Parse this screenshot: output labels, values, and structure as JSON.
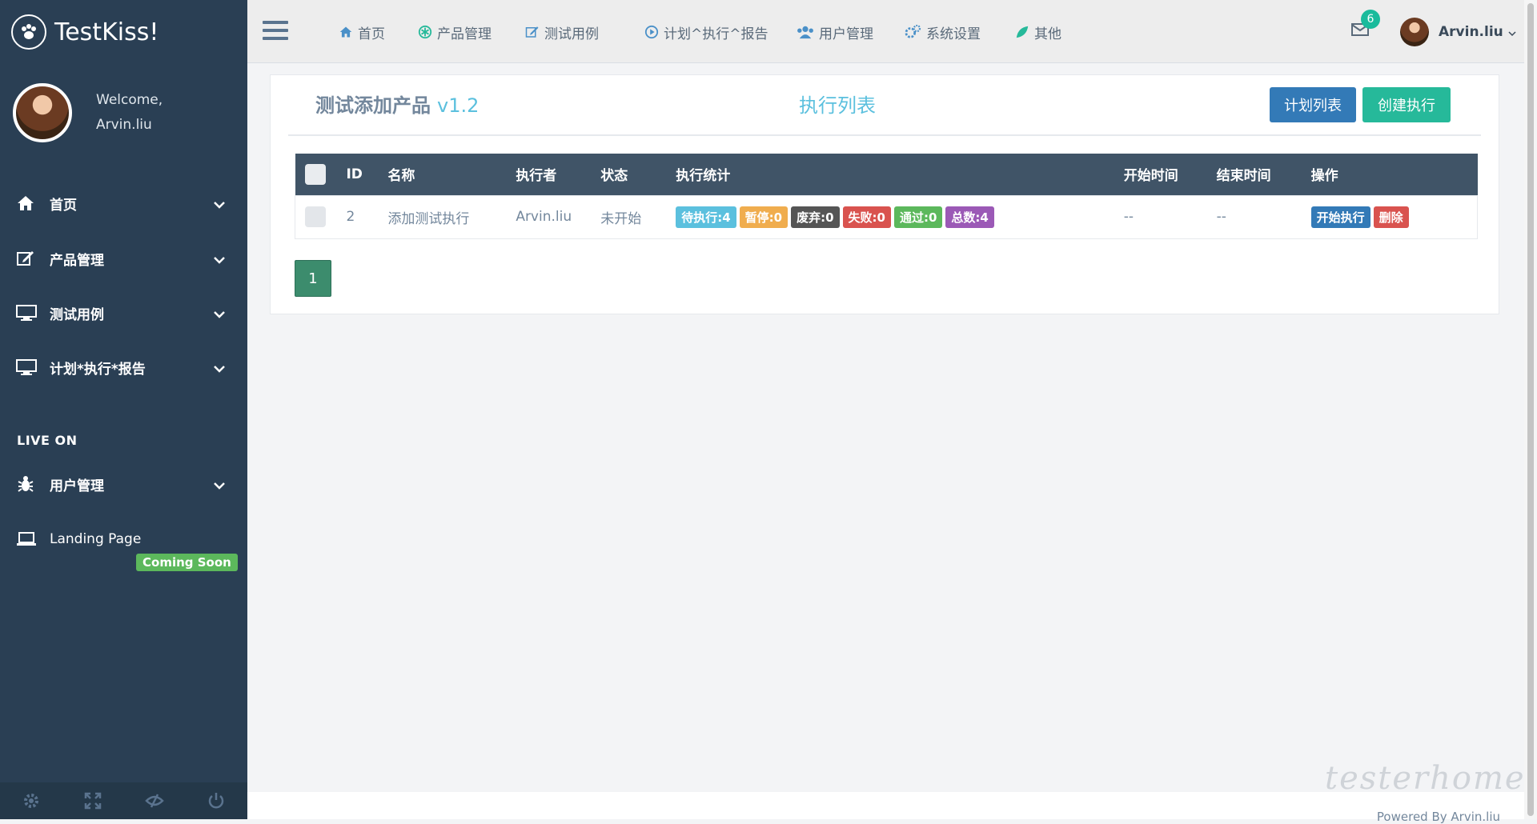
{
  "app": {
    "name": "TestKiss!"
  },
  "profile": {
    "welcome": "Welcome,",
    "name": "Arvin.liu"
  },
  "sidebar": {
    "items": [
      {
        "label": "首页",
        "icon": "home-icon"
      },
      {
        "label": "产品管理",
        "icon": "edit-icon"
      },
      {
        "label": "测试用例",
        "icon": "desktop-icon"
      },
      {
        "label": "计划*执行*报告",
        "icon": "desktop-icon"
      }
    ],
    "section_title": "LIVE ON",
    "live_items": [
      {
        "label": "用户管理",
        "icon": "bug-icon"
      },
      {
        "label": "Landing Page",
        "icon": "laptop-icon",
        "badge": "Coming Soon"
      }
    ]
  },
  "topnav": {
    "items": [
      {
        "label": "首页",
        "icon": "home-icon"
      },
      {
        "label": "产品管理",
        "icon": "asterisk-icon"
      },
      {
        "label": "测试用例",
        "icon": "edit-icon"
      },
      {
        "label": "计划^执行^报告",
        "icon": "play-circle-icon"
      },
      {
        "label": "用户管理",
        "icon": "users-icon"
      },
      {
        "label": "系统设置",
        "icon": "cogs-icon"
      },
      {
        "label": "其他",
        "icon": "leaf-icon"
      }
    ],
    "mail_count": "6",
    "user_name": "Arvin.liu"
  },
  "panel": {
    "title": "测试添加产品",
    "version": "v1.2",
    "center_title": "执行列表",
    "btn_plan_list": "计划列表",
    "btn_create": "创建执行"
  },
  "table": {
    "headers": [
      "ID",
      "名称",
      "执行者",
      "状态",
      "执行统计",
      "开始时间",
      "结束时间",
      "操作"
    ],
    "rows": [
      {
        "id": "2",
        "name": "添加测试执行",
        "executor": "Arvin.liu",
        "status": "未开始",
        "stats": [
          {
            "text": "待执行:4",
            "color": "#5bc0de"
          },
          {
            "text": "暂停:0",
            "color": "#f0ad4e"
          },
          {
            "text": "废弃:0",
            "color": "#555555"
          },
          {
            "text": "失败:0",
            "color": "#d9534f"
          },
          {
            "text": "通过:0",
            "color": "#5cb85c"
          },
          {
            "text": "总数:4",
            "color": "#9b59b6"
          }
        ],
        "start": "--",
        "end": "--",
        "op_start": "开始执行",
        "op_delete": "删除"
      }
    ]
  },
  "pagination": {
    "current": "1"
  },
  "footer": {
    "text": "Powered By Arvin.liu"
  },
  "watermark": "testerhome.com",
  "colors": {
    "sidebar": "#2a3f54",
    "accent": "#1abb9c",
    "primary": "#337ab7",
    "info": "#5bc0de"
  }
}
